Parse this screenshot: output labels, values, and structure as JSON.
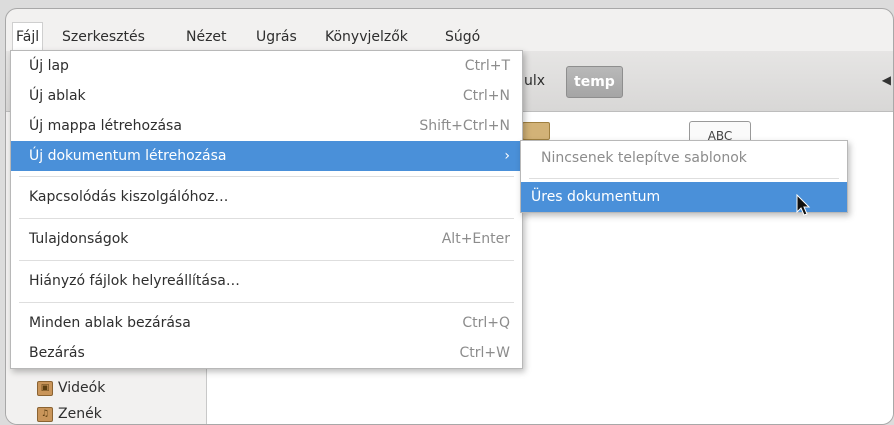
{
  "menubar": {
    "items": [
      "Fájl",
      "Szerkesztés",
      "Nézet",
      "Ugrás",
      "Könyvjelzők",
      "Súgó"
    ]
  },
  "path_bar": {
    "partial_label": "ulx",
    "active_label": "temp"
  },
  "file_menu": {
    "items": [
      {
        "label": "Új lap",
        "shortcut": "Ctrl+T"
      },
      {
        "label": "Új ablak",
        "shortcut": "Ctrl+N"
      },
      {
        "label": "Új mappa létrehozása",
        "shortcut": "Shift+Ctrl+N"
      },
      {
        "label": "Új dokumentum létrehozása",
        "submenu_arrow": "›"
      },
      {
        "label": "Kapcsolódás kiszolgálóhoz…"
      },
      {
        "label": "Tulajdonságok",
        "shortcut": "Alt+Enter"
      },
      {
        "label": "Hiányzó fájlok helyreállítása…"
      },
      {
        "label": "Minden ablak bezárása",
        "shortcut": "Ctrl+Q"
      },
      {
        "label": "Bezárás",
        "shortcut": "Ctrl+W"
      }
    ]
  },
  "new_document_submenu": {
    "disabled_item": "Nincsenek telepítve sablonok",
    "items": [
      "Üres dokumentum"
    ]
  },
  "sidebar": {
    "items": [
      {
        "label": "Videók",
        "icon": "video-folder-icon"
      },
      {
        "label": "Zenék",
        "icon": "music-folder-icon"
      }
    ]
  },
  "content": {
    "file_icon_label": "ABC"
  },
  "colors": {
    "highlight": "#4a90d9",
    "window_bg": "#f2f1f0"
  }
}
